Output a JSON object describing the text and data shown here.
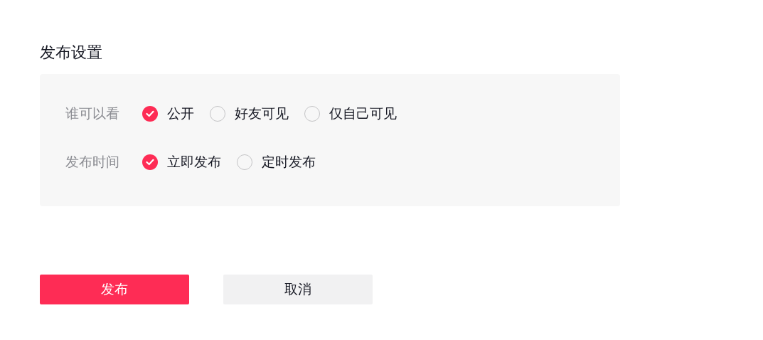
{
  "section_title": "发布设置",
  "settings": [
    {
      "label": "谁可以看",
      "options": [
        {
          "label": "公开",
          "selected": true
        },
        {
          "label": "好友可见",
          "selected": false
        },
        {
          "label": "仅自己可见",
          "selected": false
        }
      ]
    },
    {
      "label": "发布时间",
      "options": [
        {
          "label": "立即发布",
          "selected": true
        },
        {
          "label": "定时发布",
          "selected": false
        }
      ]
    }
  ],
  "buttons": [
    {
      "label": "发布",
      "kind": "primary"
    },
    {
      "label": "取消",
      "kind": "secondary"
    }
  ]
}
